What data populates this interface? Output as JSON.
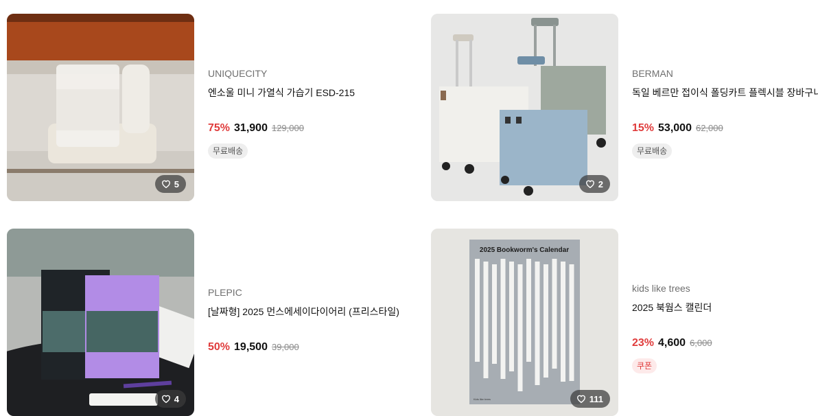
{
  "products": [
    {
      "brand": "UNIQUECITY",
      "name": "엔소울 미니 가열식 가습기 ESD-215",
      "discount": "75%",
      "price": "31,900",
      "original_price": "129,000",
      "tag": "무료배송",
      "likes": "5",
      "image_icon": "humidifier-image"
    },
    {
      "brand": "BERMAN",
      "name": "독일 베르만 접이식 폴딩카트 플렉시블 장바구니",
      "discount": "15%",
      "price": "53,000",
      "original_price": "62,000",
      "tag": "무료배송",
      "likes": "2",
      "image_icon": "folding-cart-image"
    },
    {
      "brand": "PLEPIC",
      "name": "[날짜형] 2025 먼스에세이다이어리 (프리스타일)",
      "discount": "50%",
      "price": "19,500",
      "original_price": "39,000",
      "tag": "",
      "likes": "4",
      "image_icon": "diary-image"
    },
    {
      "brand": "kids like trees",
      "name": "2025 북웜스 캘린더",
      "discount": "23%",
      "price": "4,600",
      "original_price": "6,000",
      "tag": "쿠폰",
      "likes": "111",
      "image_icon": "calendar-poster-image",
      "poster_title": "2025 Bookworm's Calendar",
      "poster_footer": "Kids like trees"
    }
  ],
  "colors": {
    "discount": "#e03c3c",
    "coupon_bg": "#fdeaea",
    "tag_bg": "#eeeeee"
  }
}
